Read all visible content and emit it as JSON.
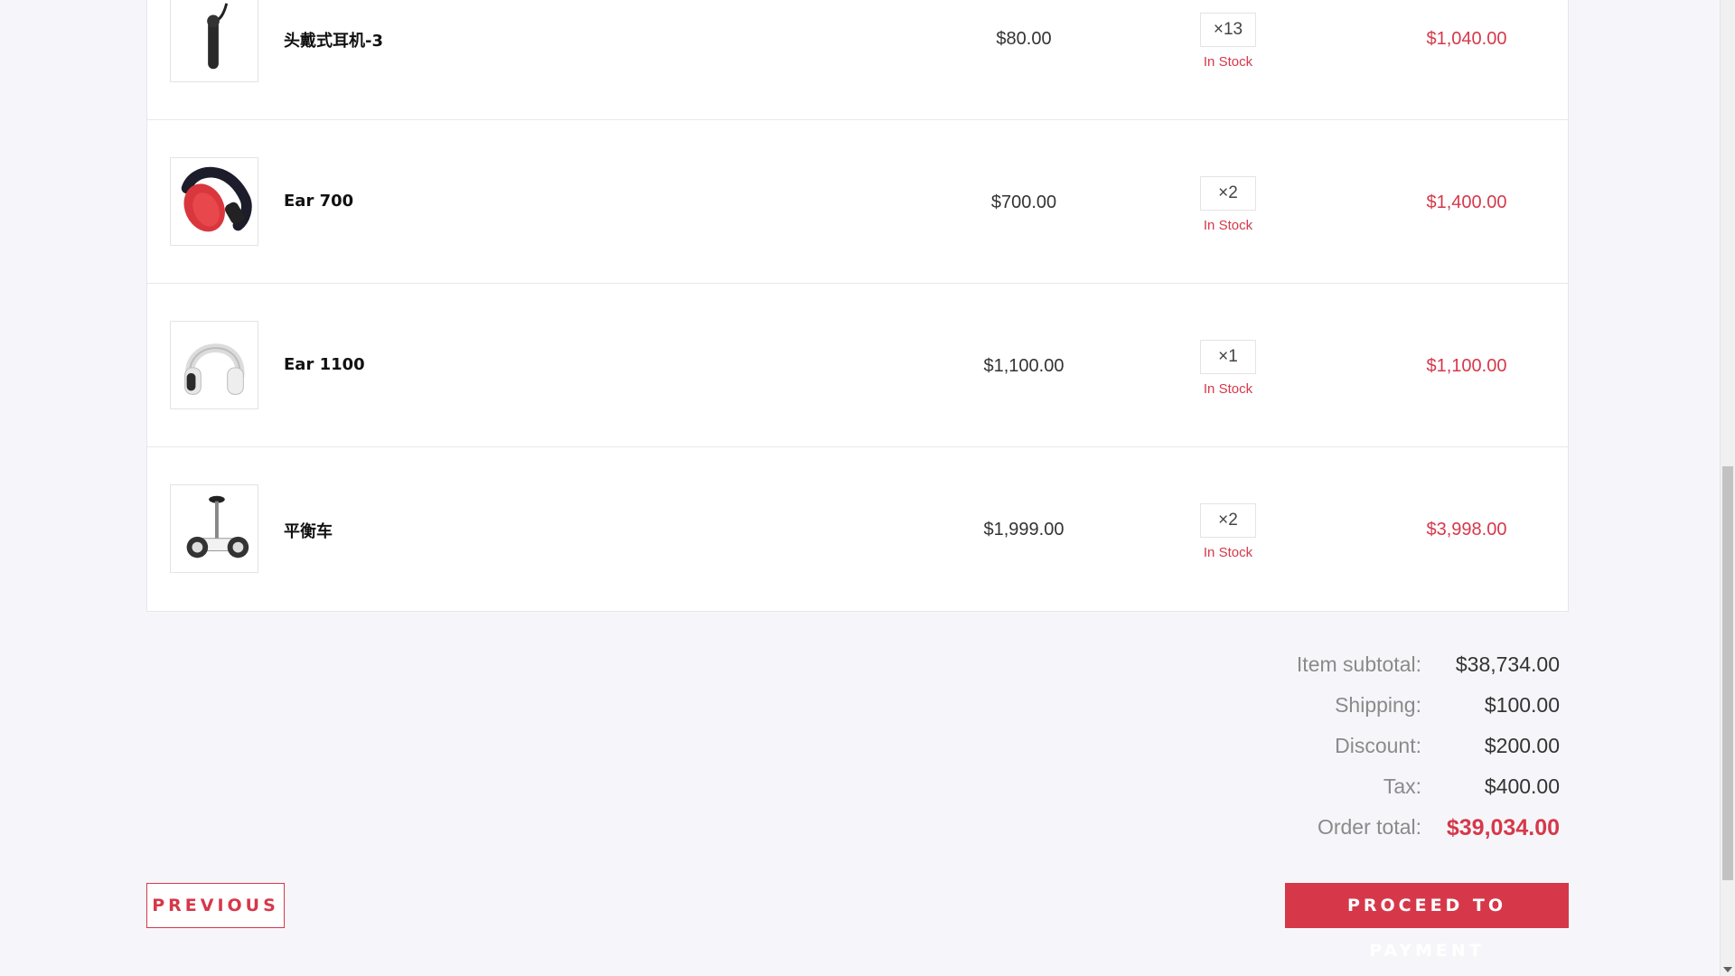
{
  "cart": {
    "items": [
      {
        "name": "头戴式耳机-3",
        "price": "$80.00",
        "quantity": "×13",
        "stock": "In Stock",
        "total": "$1,040.00",
        "image": "earpiece-icon"
      },
      {
        "name": "Ear 700",
        "price": "$700.00",
        "quantity": "×2",
        "stock": "In Stock",
        "total": "$1,400.00",
        "image": "red-headphones-icon"
      },
      {
        "name": "Ear 1100",
        "price": "$1,100.00",
        "quantity": "×1",
        "stock": "In Stock",
        "total": "$1,100.00",
        "image": "white-headphones-icon"
      },
      {
        "name": "平衡车",
        "price": "$1,999.00",
        "quantity": "×2",
        "stock": "In Stock",
        "total": "$3,998.00",
        "image": "balance-scooter-icon"
      }
    ]
  },
  "summary": {
    "subtotal_label": "Item subtotal:",
    "subtotal_value": "$38,734.00",
    "shipping_label": "Shipping:",
    "shipping_value": "$100.00",
    "discount_label": "Discount:",
    "discount_value": "$200.00",
    "tax_label": "Tax:",
    "tax_value": "$400.00",
    "total_label": "Order total:",
    "total_value": "$39,034.00"
  },
  "actions": {
    "previous_label": "PREVIOUS",
    "proceed_label": "PROCEED TO PAYMENT"
  },
  "colors": {
    "accent": "#d6384a",
    "background": "#f6f6fa"
  }
}
